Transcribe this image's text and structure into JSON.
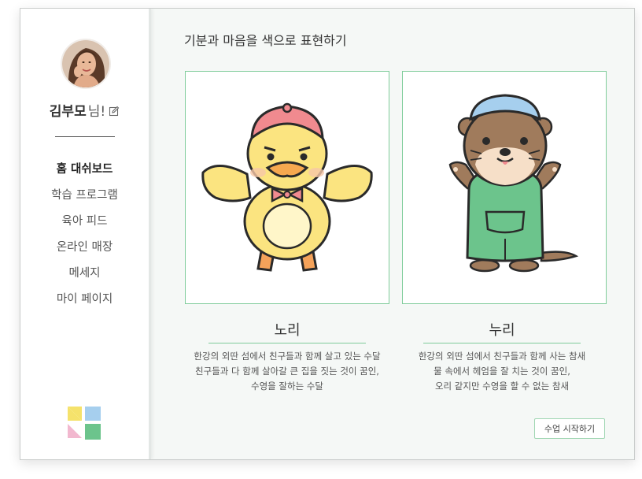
{
  "sidebar": {
    "username": "김부모",
    "username_suffix": "님!",
    "nav": [
      "홈 대쉬보드",
      "학습 프로그램",
      "육아 피드",
      "온라인 매장",
      "메세지",
      "마이 페이지"
    ],
    "active_index": 0
  },
  "main": {
    "title": "기분과 마음을 색으로 표현하기",
    "characters": [
      {
        "name": "노리",
        "desc": [
          "한강의 외딴 섬에서 친구들과 함께 살고 있는 수달",
          "친구들과 다 함께 살아갈 큰 집을 짓는 것이 꿈인,",
          "수영을 잘하는 수달"
        ]
      },
      {
        "name": "누리",
        "desc": [
          "한강의 외딴 섬에서 친구들과 함께 사는 참새",
          "물 속에서 헤엄을 잘 치는 것이 꿈인,",
          "오리 같지만 수영을 할 수 없는 참새"
        ]
      }
    ],
    "start_button": "수업 시작하기"
  },
  "colors": {
    "accent_green": "#7fcc9a",
    "logo": [
      "#f5e26b",
      "#a6cfee",
      "#f2b8cf",
      "#6cc48c"
    ]
  }
}
